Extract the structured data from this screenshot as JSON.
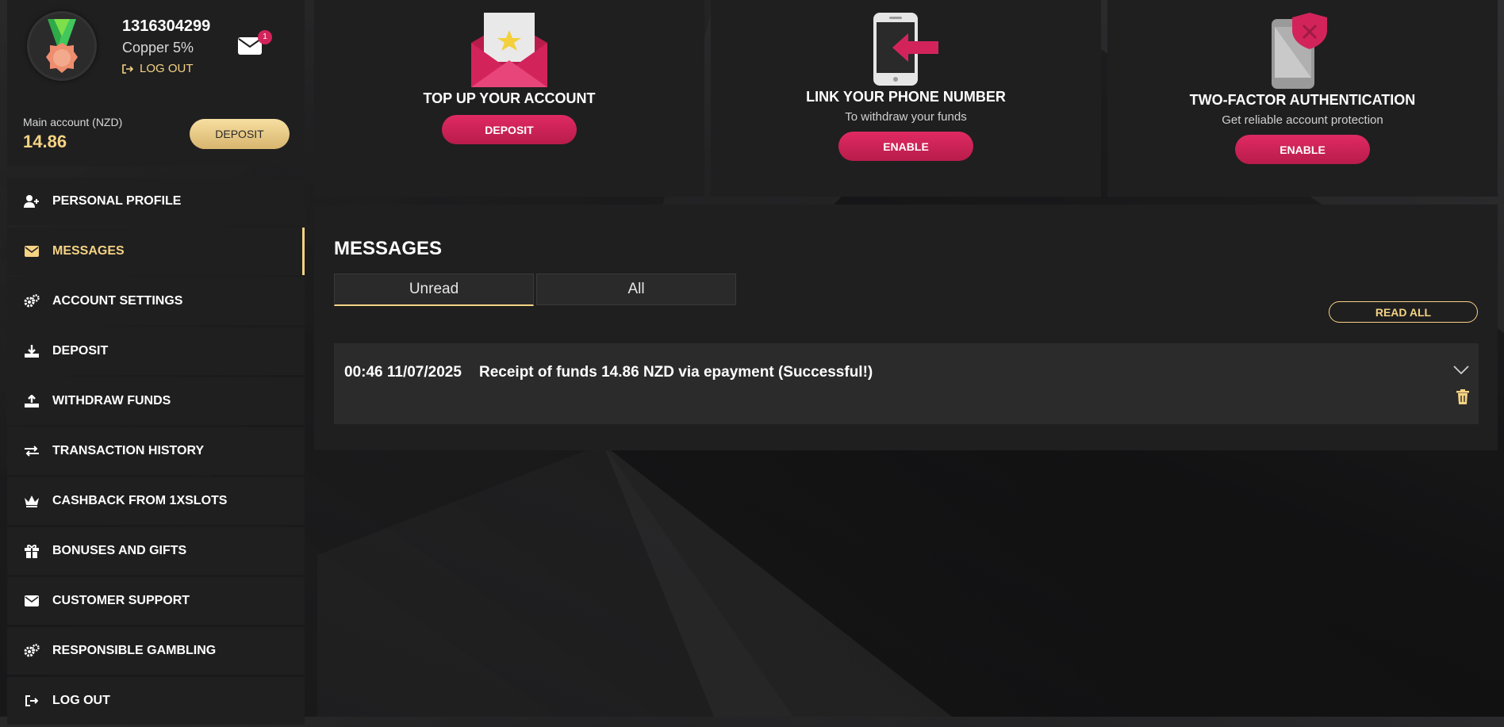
{
  "user": {
    "id": "1316304299",
    "level": "Copper 5%",
    "logout_label": "LOG OUT",
    "unread_count": "1"
  },
  "balance": {
    "label": "Main account (NZD)",
    "value": "14.86",
    "deposit_label": "DEPOSIT"
  },
  "nav": [
    {
      "label": "PERSONAL PROFILE",
      "icon": "user-plus-icon"
    },
    {
      "label": "MESSAGES",
      "icon": "envelope-icon",
      "active": true
    },
    {
      "label": "ACCOUNT SETTINGS",
      "icon": "gears-icon"
    },
    {
      "label": "DEPOSIT",
      "icon": "download-icon"
    },
    {
      "label": "WITHDRAW FUNDS",
      "icon": "upload-icon"
    },
    {
      "label": "TRANSACTION HISTORY",
      "icon": "exchange-icon"
    },
    {
      "label": "CASHBACK FROM 1XSLOTS",
      "icon": "crown-icon"
    },
    {
      "label": "BONUSES AND GIFTS",
      "icon": "gift-icon"
    },
    {
      "label": "CUSTOMER SUPPORT",
      "icon": "envelope-icon"
    },
    {
      "label": "RESPONSIBLE GAMBLING",
      "icon": "gears-icon"
    },
    {
      "label": "LOG OUT",
      "icon": "logout-icon"
    }
  ],
  "cards": {
    "topup": {
      "title": "TOP UP YOUR ACCOUNT",
      "button": "DEPOSIT",
      "icon": "envelope-star-icon"
    },
    "phone": {
      "title": "LINK YOUR PHONE NUMBER",
      "subtitle": "To withdraw your funds",
      "button": "ENABLE",
      "icon": "phone-arrow-icon"
    },
    "twofa": {
      "title": "TWO-FACTOR AUTHENTICATION",
      "subtitle": "Get reliable account protection",
      "button": "ENABLE",
      "icon": "phone-shield-icon"
    }
  },
  "messages": {
    "title": "MESSAGES",
    "tabs": [
      {
        "label": "Unread",
        "active": true
      },
      {
        "label": "All"
      }
    ],
    "read_all": "READ ALL",
    "items": [
      {
        "time": "00:46 11/07/2025",
        "text": "Receipt of funds 14.86 NZD via epayment (Successful!)"
      }
    ]
  },
  "colors": {
    "accent_gold": "#f5d383",
    "accent_pink": "#d2245b",
    "panel": "#1f1f20"
  }
}
